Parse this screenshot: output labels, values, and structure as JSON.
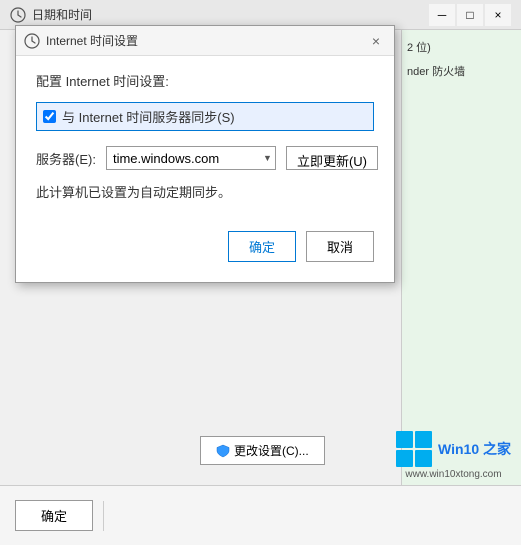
{
  "bg_window": {
    "title": "日期和时间",
    "close_label": "×"
  },
  "right_panel": {
    "line1": "2 位)",
    "line2": "nder 防火墙"
  },
  "dialog": {
    "title": "Internet 时间设置",
    "close_label": "×",
    "section_title": "配置 Internet 时间设置:",
    "checkbox_label": "与 Internet 时间服务器同步(S)",
    "server_label": "服务器(E):",
    "server_value": "time.windows.com",
    "update_button_label": "立即更新(U)",
    "status_text": "此计算机已设置为自动定期同步。",
    "ok_label": "确定",
    "cancel_label": "取消"
  },
  "more_settings": {
    "label": "更改设置(C)..."
  },
  "bottom_bar": {
    "ok_label": "确定"
  },
  "win10": {
    "brand": "Win10 之家",
    "url": "www.win10xtong.com"
  }
}
